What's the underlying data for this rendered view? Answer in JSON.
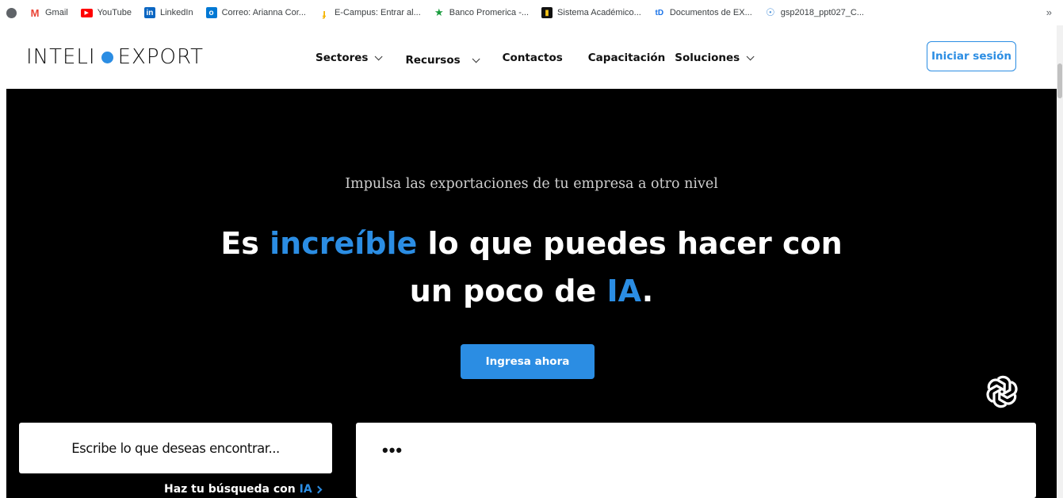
{
  "bookmarks": [
    {
      "label": "",
      "icon": "globe-icon",
      "color": "#5f6368"
    },
    {
      "label": "Gmail",
      "icon": "gmail-icon",
      "color": "#ea4335"
    },
    {
      "label": "YouTube",
      "icon": "youtube-icon",
      "color": "#ff0000"
    },
    {
      "label": "LinkedIn",
      "icon": "linkedin-icon",
      "color": "#0a66c2"
    },
    {
      "label": "Correo: Arianna Cor...",
      "icon": "outlook-icon",
      "color": "#0078d4"
    },
    {
      "label": "E-Campus: Entrar al...",
      "icon": "ecampus-icon",
      "color": "#f4b400"
    },
    {
      "label": "Banco Promerica -...",
      "icon": "star-icon",
      "color": "#1a9c3e"
    },
    {
      "label": "Sistema Académico...",
      "icon": "sistema-icon",
      "color": "#f5c518"
    },
    {
      "label": "Documentos de EX...",
      "icon": "td-icon",
      "color": "#1a73e8"
    },
    {
      "label": "gsp2018_ppt027_C...",
      "icon": "un-icon",
      "color": "#4a90d9"
    }
  ],
  "bookmarks_more": "»",
  "header": {
    "logo_left": "INTELI",
    "logo_right": "EXPORT",
    "logo_dot_color": "#2b8de3",
    "nav": [
      {
        "label": "Sectores",
        "dropdown": true
      },
      {
        "label": "Recursos",
        "dropdown": true
      },
      {
        "label": "Contactos",
        "dropdown": false
      },
      {
        "label": "Capacitación",
        "dropdown": false
      },
      {
        "label": "Soluciones",
        "dropdown": true
      }
    ],
    "login_label": "Iniciar sesión"
  },
  "hero": {
    "kicker": "Impulsa las exportaciones de tu empresa a otro nivel",
    "headline_1a": "Es ",
    "headline_1b": "increíble",
    "headline_1c": " lo que puedes hacer con",
    "headline_2a": "un poco de ",
    "headline_2b": "IA",
    "headline_2c": ".",
    "cta_label": "Ingresa ahora",
    "accent_color": "#2b8de3",
    "ai_icon": "openai-icon"
  },
  "search": {
    "placeholder": "Escribe lo que deseas encontrar...",
    "ai_link_prefix": "Haz tu búsqueda con ",
    "ai_link_accent": "IA",
    "result_loading": "•••"
  }
}
